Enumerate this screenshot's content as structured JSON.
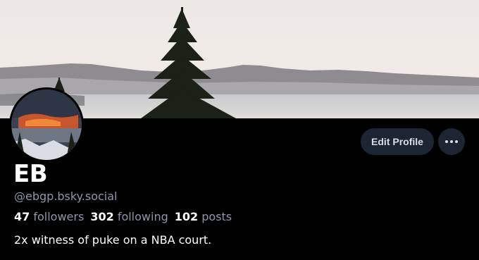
{
  "profile": {
    "display_name": "EB",
    "handle": "@ebgp.bsky.social",
    "bio": "2x witness of puke on a NBA court."
  },
  "stats": {
    "followers_count": "47",
    "followers_label": "followers",
    "following_count": "302",
    "following_label": "following",
    "posts_count": "102",
    "posts_label": "posts"
  },
  "actions": {
    "edit_profile_label": "Edit Profile",
    "more_icon": "more-horizontal-icon"
  },
  "colors": {
    "background": "#000000",
    "button_bg": "#1e2532",
    "muted_text": "#8d97a8"
  }
}
